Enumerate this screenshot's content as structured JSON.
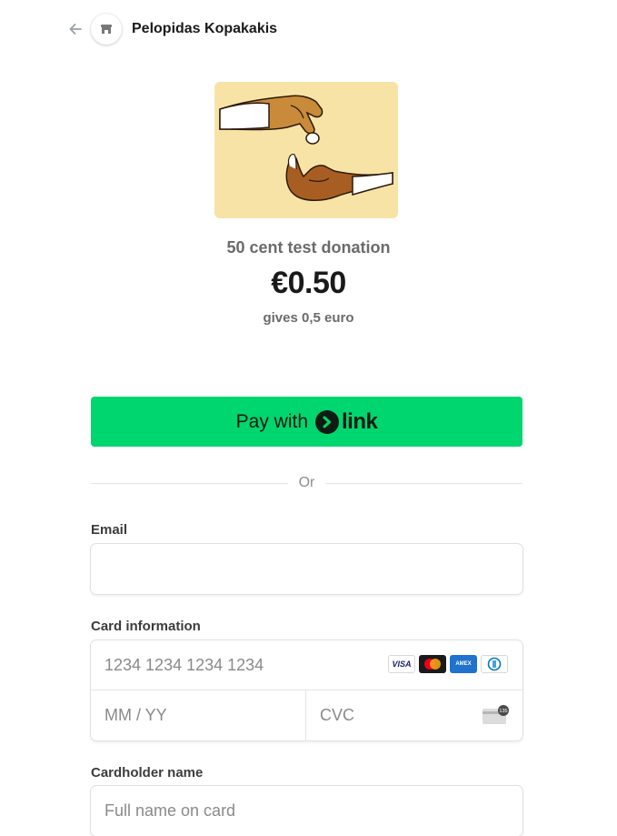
{
  "header": {
    "back_icon": "arrow-left-icon",
    "merchant_icon": "store-icon",
    "merchant_name": "Pelopidas Kopakakis"
  },
  "product": {
    "image_icon": "hands-giving-coin-illustration",
    "name": "50 cent test donation",
    "price": "€0.50",
    "description": "gives 0,5 euro"
  },
  "link_button": {
    "pay_with": "Pay with",
    "brand": "link",
    "color": "#00d66f"
  },
  "divider": {
    "label": "Or"
  },
  "email": {
    "label": "Email",
    "value": "",
    "placeholder": ""
  },
  "card": {
    "label": "Card information",
    "number_placeholder": "1234 1234 1234 1234",
    "expiry_placeholder": "MM / YY",
    "cvc_placeholder": "CVC",
    "cvc_icon_text": "135",
    "brands": [
      {
        "name": "visa",
        "text": "VISA"
      },
      {
        "name": "mastercard",
        "text": ""
      },
      {
        "name": "amex",
        "text": "AMEX"
      },
      {
        "name": "diners",
        "text": ""
      }
    ]
  },
  "cardholder": {
    "label": "Cardholder name",
    "placeholder": "Full name on card"
  }
}
